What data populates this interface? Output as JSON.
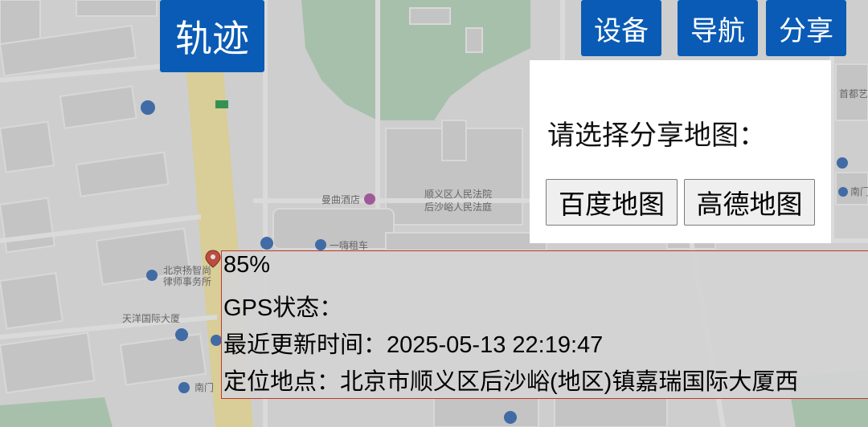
{
  "toolbar": {
    "track_label": "轨迹",
    "device_label": "设备",
    "navigation_label": "导航",
    "share_label": "分享"
  },
  "share_dialog": {
    "prompt": "请选择分享地图：",
    "options": [
      "百度地图",
      "高德地图"
    ]
  },
  "device_info": {
    "battery": "85%",
    "gps_status": "GPS状态：",
    "last_update": "最近更新时间：2025-05-13 22:19:47",
    "location": "定位地点：北京市顺义区后沙峪(地区)镇嘉瑞国际大厦西"
  },
  "map_labels": {
    "hotel": "曼曲酒店",
    "court_line1": "顺义区人民法院",
    "court_line2": "后沙峪人民法庭",
    "law_firm_line1": "北京扬智尚",
    "law_firm_line2": "律师事务所",
    "building": "天洋国际大厦",
    "south_gate_left": "南门",
    "south_gate_right": "南门",
    "rental": "一嗨租车",
    "museum": "首都艺术"
  },
  "colors": {
    "toolbar_button": "#0a5bb5",
    "info_border": "#c0392b"
  }
}
